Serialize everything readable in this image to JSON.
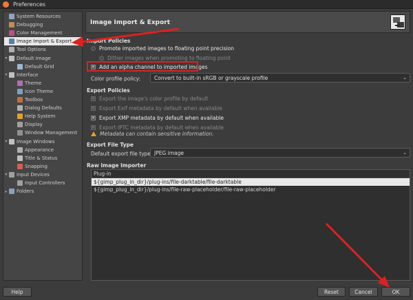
{
  "window": {
    "title": "Preferences"
  },
  "sidebar": {
    "items": [
      {
        "label": "System Resources",
        "depth": 0,
        "expander": "",
        "icon_color": "#8fa5c0"
      },
      {
        "label": "Debugging",
        "depth": 0,
        "expander": "",
        "icon_color": "#c08a5a"
      },
      {
        "label": "Color Management",
        "depth": 0,
        "expander": "",
        "icon_color": "#c05080"
      },
      {
        "label": "Image Import & Export",
        "depth": 0,
        "expander": "",
        "icon_color": "#5a7fb0",
        "selected": true
      },
      {
        "label": "Tool Options",
        "depth": 0,
        "expander": "",
        "icon_color": "#b0b0b0"
      },
      {
        "label": "Default Image",
        "depth": 0,
        "expander": "▾",
        "icon_color": "#c0c0c0"
      },
      {
        "label": "Default Grid",
        "depth": 1,
        "expander": "",
        "icon_color": "#9cb5d0"
      },
      {
        "label": "Interface",
        "depth": 0,
        "expander": "▾",
        "icon_color": "#c0c0c0"
      },
      {
        "label": "Theme",
        "depth": 1,
        "expander": "",
        "icon_color": "#b06fb0"
      },
      {
        "label": "Icon Theme",
        "depth": 1,
        "expander": "",
        "icon_color": "#7fa0c0"
      },
      {
        "label": "Toolbox",
        "depth": 1,
        "expander": "",
        "icon_color": "#c07040"
      },
      {
        "label": "Dialog Defaults",
        "depth": 1,
        "expander": "",
        "icon_color": "#b0b0b0"
      },
      {
        "label": "Help System",
        "depth": 1,
        "expander": "",
        "icon_color": "#e0a030"
      },
      {
        "label": "Display",
        "depth": 1,
        "expander": "",
        "icon_color": "#a0a0a0"
      },
      {
        "label": "Window Management",
        "depth": 1,
        "expander": "",
        "icon_color": "#909090"
      },
      {
        "label": "Image Windows",
        "depth": 0,
        "expander": "▾",
        "icon_color": "#c0c0c0"
      },
      {
        "label": "Appearance",
        "depth": 1,
        "expander": "",
        "icon_color": "#b0b0b0"
      },
      {
        "label": "Title & Status",
        "depth": 1,
        "expander": "",
        "icon_color": "#c0c0c0"
      },
      {
        "label": "Snapping",
        "depth": 1,
        "expander": "",
        "icon_color": "#d06050"
      },
      {
        "label": "Input Devices",
        "depth": 0,
        "expander": "▾",
        "icon_color": "#a0a0a0"
      },
      {
        "label": "Input Controllers",
        "depth": 1,
        "expander": "",
        "icon_color": "#a0a0a0"
      },
      {
        "label": "Folders",
        "depth": 0,
        "expander": "▸",
        "icon_color": "#8aa0c0"
      }
    ]
  },
  "header": {
    "title": "Image Import & Export"
  },
  "import_policies": {
    "title": "Import Policies",
    "promote_label": "Promote imported images to floating point precision",
    "dither_label": "Dither images when promoting to floating point",
    "alpha_label": "Add an alpha channel to imported images",
    "color_profile_label": "Color profile policy:",
    "color_profile_value": "Convert to built-in sRGB or grayscale profile"
  },
  "export_policies": {
    "title": "Export Policies",
    "items": [
      {
        "label": "Export the image's color profile by default",
        "enabled": false
      },
      {
        "label": "Export Exif metadata by default when available",
        "enabled": false
      },
      {
        "label": "Export XMP metadata by default when available",
        "enabled": true
      },
      {
        "label": "Export IPTC metadata by default when available",
        "enabled": false
      }
    ],
    "warning": "Metadata can contain sensitive information."
  },
  "export_file_type": {
    "title": "Export File Type",
    "label": "Default export file type:",
    "value": "JPEG image"
  },
  "raw_importer": {
    "title": "Raw Image Importer",
    "column_header": "Plug-in",
    "rows": [
      "${gimp_plug_in_dir}/plug-ins/file-darktable/file-darktable",
      "${gimp_plug_in_dir}/plug-ins/file-raw-placeholder/file-raw-placeholder"
    ]
  },
  "buttons": {
    "help": "Help",
    "reset": "Reset",
    "cancel": "Cancel",
    "ok": "OK"
  },
  "colors": {
    "annotation": "#e02020",
    "selection": "#e8e8e8",
    "warning": "#e8a020"
  }
}
